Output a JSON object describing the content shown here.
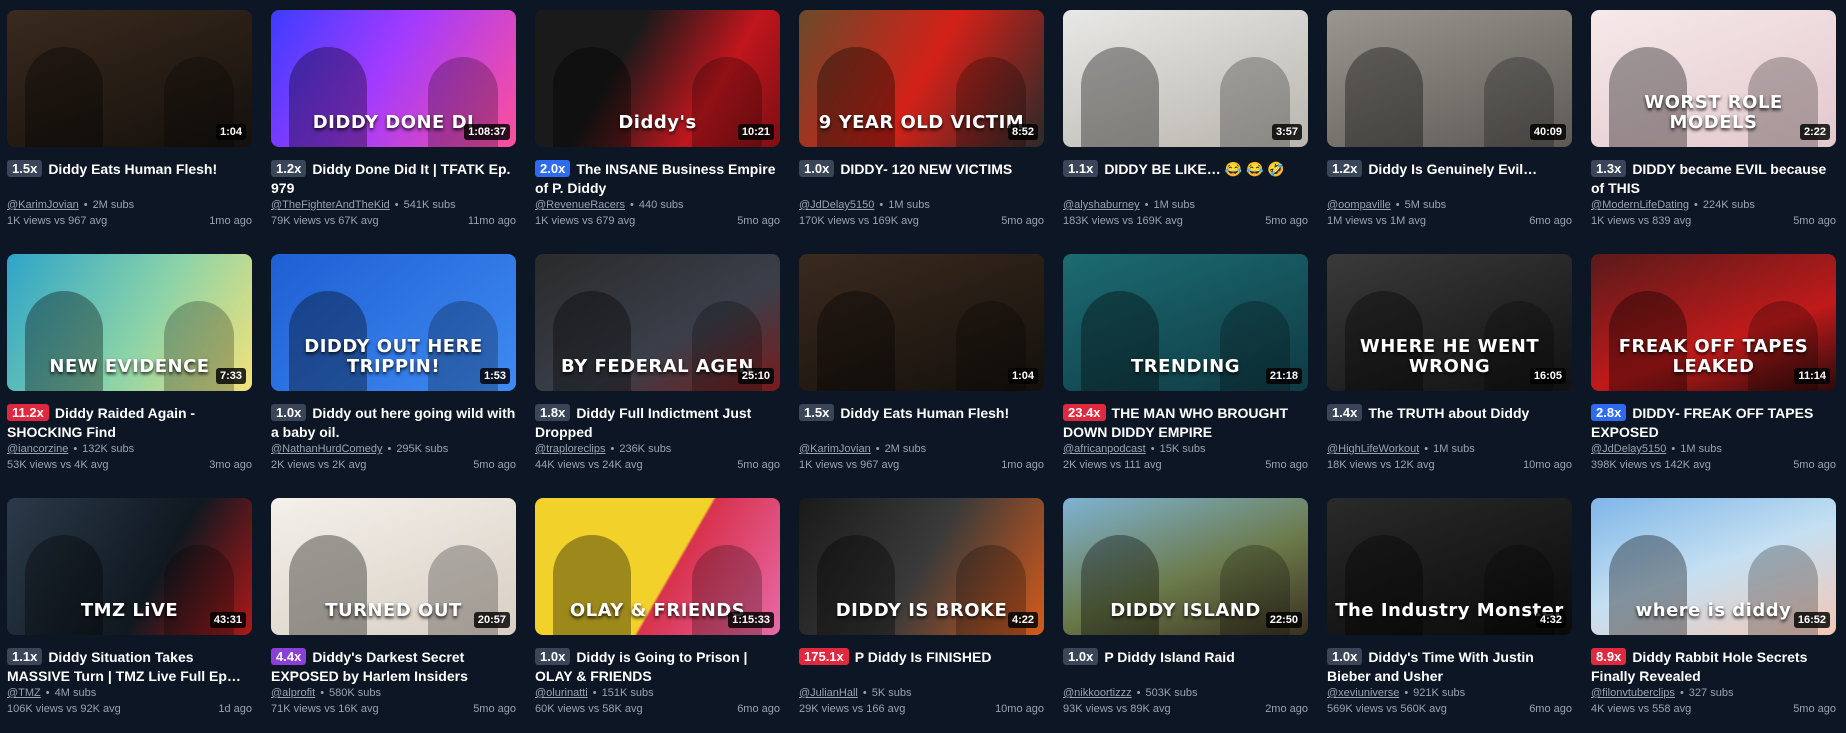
{
  "colors": {
    "background": "#0d1624",
    "badge_neutral": "#3a4658",
    "badge_blue": "#2d6bf0",
    "badge_red": "#e0293f",
    "badge_purple": "#8a3fd6",
    "meta_text": "#9aa3b0"
  },
  "videos": [
    {
      "thumb_text": "",
      "thumb_bg": "linear-gradient(160deg,#3a2a1e,#14100c)",
      "duration": "1:04",
      "multiplier": "1.5x",
      "badge": "#3a4658",
      "title": "Diddy Eats Human Flesh!",
      "channel": "@KarimJovian",
      "subs": "2M subs",
      "views": "1K views vs 967 avg",
      "age": "1mo ago"
    },
    {
      "thumb_text": "DIDDY DONE DI",
      "thumb_bg": "linear-gradient(120deg,#3d3cff,#a23bff 45%,#ff4f9a)",
      "duration": "1:08:37",
      "multiplier": "1.2x",
      "badge": "#3a4658",
      "title": "Diddy Done Did It | TFATK Ep. 979",
      "channel": "@TheFighterAndTheKid",
      "subs": "541K subs",
      "views": "79K views vs 67K avg",
      "age": "11mo ago"
    },
    {
      "thumb_text": "Diddy's",
      "thumb_bg": "linear-gradient(120deg,#1a1a1a 35%,#c0161d 70%,#7d0e12)",
      "duration": "10:21",
      "multiplier": "2.0x",
      "badge": "#2d6bf0",
      "title": "The INSANE Business Empire of P. Diddy",
      "channel": "@RevenueRacers",
      "subs": "440 subs",
      "views": "1K views vs 679 avg",
      "age": "5mo ago"
    },
    {
      "thumb_text": "9 YEAR OLD VICTIM",
      "thumb_bg": "linear-gradient(120deg,#6a4a2a,#d32118 50%,#2a2a2a)",
      "duration": "8:52",
      "multiplier": "1.0x",
      "badge": "#3a4658",
      "title": "DIDDY- 120 NEW VICTIMS",
      "channel": "@JdDelay5150",
      "subs": "1M subs",
      "views": "170K views vs 169K avg",
      "age": "5mo ago"
    },
    {
      "thumb_text": "",
      "thumb_bg": "linear-gradient(160deg,#e8e8e6,#b9b5ae)",
      "duration": "3:57",
      "multiplier": "1.1x",
      "badge": "#3a4658",
      "title": "DIDDY BE LIKE… 😂 😂 🤣",
      "channel": "@alyshaburney",
      "subs": "1M subs",
      "views": "183K views vs 169K avg",
      "age": "5mo ago"
    },
    {
      "thumb_text": "",
      "thumb_bg": "linear-gradient(160deg,#9a9690,#5d5a55)",
      "duration": "40:09",
      "multiplier": "1.2x",
      "badge": "#3a4658",
      "title": "Diddy Is Genuinely Evil…",
      "channel": "@oompaville",
      "subs": "5M subs",
      "views": "1M views vs 1M avg",
      "age": "6mo ago"
    },
    {
      "thumb_text": "WORST ROLE MODELS",
      "thumb_bg": "linear-gradient(160deg,#f6e9ea,#e3c8cc)",
      "duration": "2:22",
      "multiplier": "1.3x",
      "badge": "#3a4658",
      "title": "DIDDY became EVIL because of THIS",
      "channel": "@ModernLifeDating",
      "subs": "224K subs",
      "views": "1K views vs 839 avg",
      "age": "5mo ago"
    },
    {
      "thumb_text": "NEW EVIDENCE",
      "thumb_bg": "linear-gradient(120deg,#2ea4c9,#8bd3a8 55%,#f3e27a)",
      "duration": "7:33",
      "multiplier": "11.2x",
      "badge": "#e0293f",
      "title": "Diddy Raided Again - SHOCKING Find",
      "channel": "@iancorzine",
      "subs": "132K subs",
      "views": "53K views vs 4K avg",
      "age": "3mo ago"
    },
    {
      "thumb_text": "DIDDY OUT HERE TRIPPIN!",
      "thumb_bg": "linear-gradient(140deg,#1f5fd4,#3f8bf2)",
      "duration": "1:53",
      "multiplier": "1.0x",
      "badge": "#3a4658",
      "title": "Diddy out here going wild with a baby oil.",
      "channel": "@NathanHurdComedy",
      "subs": "295K subs",
      "views": "2K views vs 2K avg",
      "age": "5mo ago"
    },
    {
      "thumb_text": "BY FEDERAL AGEN",
      "thumb_bg": "linear-gradient(150deg,#2a2a2a,#3a3f4a 60%,#7a1b1b)",
      "duration": "25:10",
      "multiplier": "1.8x",
      "badge": "#3a4658",
      "title": "Diddy Full Indictment Just Dropped",
      "channel": "@traploreclips",
      "subs": "236K subs",
      "views": "44K views vs 24K avg",
      "age": "5mo ago"
    },
    {
      "thumb_text": "",
      "thumb_bg": "linear-gradient(160deg,#3a2a1e,#14100c)",
      "duration": "1:04",
      "multiplier": "1.5x",
      "badge": "#3a4658",
      "title": "Diddy Eats Human Flesh!",
      "channel": "@KarimJovian",
      "subs": "2M subs",
      "views": "1K views vs 967 avg",
      "age": "1mo ago"
    },
    {
      "thumb_text": "TRENDING",
      "thumb_bg": "linear-gradient(160deg,#1c6b72,#0f3a44)",
      "duration": "21:18",
      "multiplier": "23.4x",
      "badge": "#e0293f",
      "title": "THE MAN WHO BROUGHT DOWN DIDDY EMPIRE",
      "channel": "@africanpodcast",
      "subs": "15K subs",
      "views": "2K views vs 111 avg",
      "age": "5mo ago"
    },
    {
      "thumb_text": "WHERE HE WENT WRONG",
      "thumb_bg": "linear-gradient(160deg,#3a3a3a,#111)",
      "duration": "16:05",
      "multiplier": "1.4x",
      "badge": "#3a4658",
      "title": "The TRUTH about Diddy",
      "channel": "@HighLifeWorkout",
      "subs": "1M subs",
      "views": "18K views vs 12K avg",
      "age": "10mo ago"
    },
    {
      "thumb_text": "FREAK OFF TAPES LEAKED",
      "thumb_bg": "linear-gradient(160deg,#5a1a1a,#c01a1a 60%,#2a0a0a)",
      "duration": "11:14",
      "multiplier": "2.8x",
      "badge": "#2d6bf0",
      "title": "DIDDY- FREAK OFF TAPES EXPOSED",
      "channel": "@JdDelay5150",
      "subs": "1M subs",
      "views": "398K views vs 142K avg",
      "age": "5mo ago"
    },
    {
      "thumb_text": "TMZ LiVE",
      "thumb_bg": "linear-gradient(120deg,#2b3a4a,#101820 60%,#b01818)",
      "duration": "43:31",
      "multiplier": "1.1x",
      "badge": "#3a4658",
      "title": "Diddy Situation Takes MASSIVE Turn | TMZ Live Full Ep…",
      "channel": "@TMZ",
      "subs": "4M subs",
      "views": "106K views vs 92K avg",
      "age": "1d ago"
    },
    {
      "thumb_text": "TURNED OUT",
      "thumb_bg": "linear-gradient(160deg,#f4f0ea,#d8cfc4)",
      "duration": "20:57",
      "multiplier": "4.4x",
      "badge": "#8a3fd6",
      "title": "Diddy's Darkest Secret EXPOSED by Harlem Insiders",
      "channel": "@alprofit",
      "subs": "580K subs",
      "views": "71K views vs 16K avg",
      "age": "5mo ago"
    },
    {
      "thumb_text": "OLAY & FRIENDS",
      "thumb_bg": "linear-gradient(120deg,#f2d12a 55%,#d8324d 56%,#e86aa8)",
      "duration": "1:15:33",
      "multiplier": "1.0x",
      "badge": "#3a4658",
      "title": "Diddy is Going to Prison | OLAY & FRIENDS",
      "channel": "@olurinatti",
      "subs": "151K subs",
      "views": "60K views vs 58K avg",
      "age": "6mo ago"
    },
    {
      "thumb_text": "DIDDY IS BROKE",
      "thumb_bg": "linear-gradient(120deg,#1a1a1a,#3a3a3a 50%,#d65a1a)",
      "duration": "4:22",
      "multiplier": "175.1x",
      "badge": "#e0293f",
      "title": "P Diddy Is FINISHED",
      "channel": "@JulianHall",
      "subs": "5K subs",
      "views": "29K views vs 166 avg",
      "age": "10mo ago"
    },
    {
      "thumb_text": "DIDDY ISLAND",
      "thumb_bg": "linear-gradient(160deg,#7eb3d4,#6b7a4a 55%,#3a3020)",
      "duration": "22:50",
      "multiplier": "1.0x",
      "badge": "#3a4658",
      "title": "P Diddy Island Raid",
      "channel": "@nikkoortizzz",
      "subs": "503K subs",
      "views": "93K views vs 89K avg",
      "age": "2mo ago"
    },
    {
      "thumb_text": "The Industry Monster",
      "thumb_bg": "linear-gradient(160deg,#2a2a2a,#0a0a0a)",
      "duration": "4:32",
      "multiplier": "1.0x",
      "badge": "#3a4658",
      "title": "Diddy's Time With Justin Bieber and Usher",
      "channel": "@xeviuniverse",
      "subs": "921K subs",
      "views": "569K views vs 560K avg",
      "age": "6mo ago"
    },
    {
      "thumb_text": "where is diddy",
      "thumb_bg": "linear-gradient(160deg,#7fb6e8,#c5e0f2 50%,#f3c7b5)",
      "duration": "16:52",
      "multiplier": "8.9x",
      "badge": "#e0293f",
      "title": "Diddy Rabbit Hole Secrets Finally Revealed",
      "channel": "@filonvtuberclips",
      "subs": "327 subs",
      "views": "4K views vs 558 avg",
      "age": "5mo ago"
    }
  ]
}
